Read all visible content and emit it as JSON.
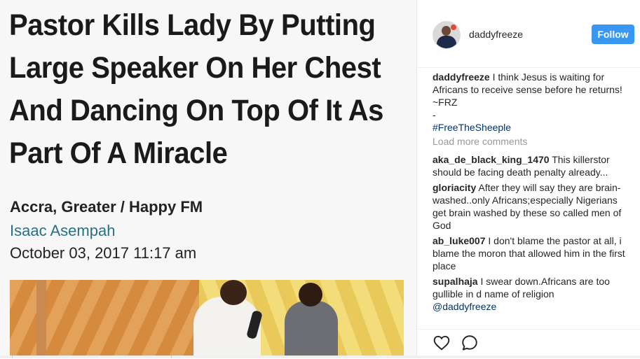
{
  "article": {
    "headline_line1": "Pastor Kills Lady By Putting",
    "headline_line2": "Large Speaker On Her Chest",
    "headline_line3": "And Dancing On Top Of It As",
    "headline_line4": "Part Of A Miracle",
    "source": "Accra, Greater / Happy FM",
    "author": "Isaac Asempah",
    "date": "October 03, 2017 11:17 am"
  },
  "header": {
    "username": "daddyfreeze",
    "follow_label": "Follow",
    "accent_color": "#3897f0"
  },
  "caption": {
    "user": "daddyfreeze",
    "text": "I think Jesus is waiting for Africans to receive sense before he returns! ~FRZ",
    "dash": "-",
    "hashtag": "#FreeTheSheeple"
  },
  "load_more": "Load more comments",
  "comments": [
    {
      "user": "aka_de_black_king_1470",
      "text": "This killerstor should be facing death penalty already..."
    },
    {
      "user": "gloriacity",
      "text": "After they will say they are brain-washed..only Africans;especially Nigerians get brain washed by these so called men of God"
    },
    {
      "user": "ab_luke007",
      "text": "I don't blame the pastor at all, i blame the moron that allowed him in the first place"
    },
    {
      "user": "supalhaja",
      "text": "I swear down.Africans are too gullible in d name of religion",
      "mention": "@daddyfreeze"
    }
  ],
  "icons": {
    "like": "heart-icon",
    "comment": "comment-icon"
  }
}
